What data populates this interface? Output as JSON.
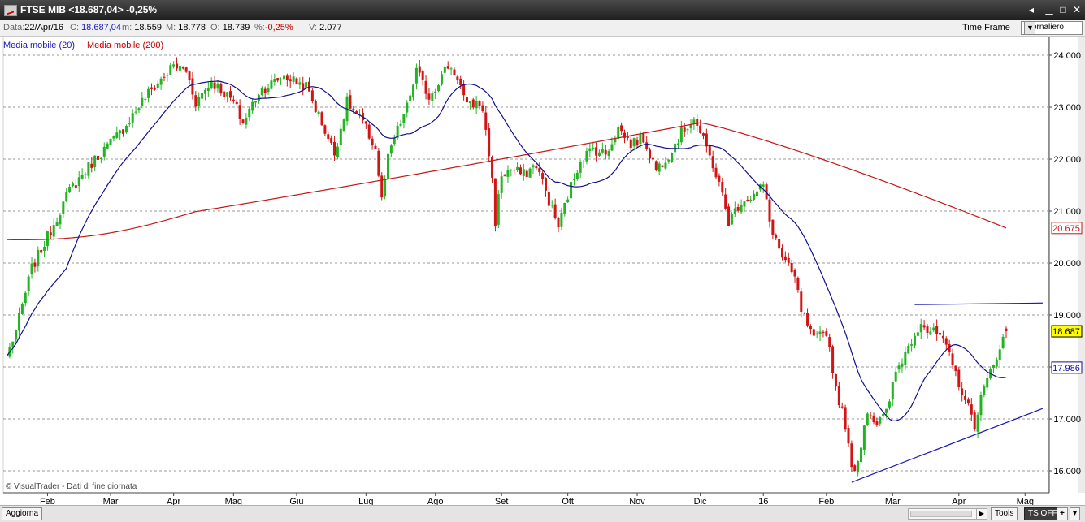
{
  "window": {
    "title": "FTSE MIB <18.687,04> -0,25%",
    "buttons": [
      "◂",
      "▁",
      "□",
      "✕"
    ],
    "app_icon": "chart-app-icon"
  },
  "infobar": {
    "data_label": "Data:",
    "data_value": "22/Apr/16",
    "c_label": "C:",
    "c_value": "18.687,04",
    "m_label": "m:",
    "m_value": "18.559",
    "M_label": "M:",
    "M_value": "18.778",
    "o_label": "O:",
    "o_value": "18.739",
    "pct_label": "%:",
    "pct_value": "-0,25%",
    "v_label": "V:",
    "v_value": "2.077",
    "timeframe_label": "Time Frame",
    "timeframe_value": "Giornaliero"
  },
  "legend": {
    "ma20": "Media mobile (20)",
    "ma200": "Media mobile (200)"
  },
  "credit": "© VisualTrader - Dati di fine giornata",
  "bottombar": {
    "refresh": "Aggiorna",
    "tools": "Tools",
    "tsoff": "TS OFF",
    "plus": "+",
    "menu": "▾"
  },
  "colors": {
    "up": "#22b422",
    "down": "#d21414",
    "ma20": "#101090",
    "ma200": "#c41818",
    "trendline": "#1a1ab4",
    "grid": "#9a9a9a",
    "price_badge": "#ffff00"
  },
  "chart_data": {
    "type": "candlestick",
    "title": "FTSE MIB <18.687,04> -0,25%",
    "ylim": [
      15600,
      24300
    ],
    "y_ticks": [
      16000,
      17000,
      18000,
      19000,
      20000,
      21000,
      22000,
      23000,
      24000
    ],
    "y_tick_labels": [
      "16.000",
      "17.000",
      "18.000",
      "19.000",
      "20.000",
      "21.000",
      "22.000",
      "23.000",
      "24.000"
    ],
    "x_ticks": [
      {
        "label": "Feb",
        "i": 13
      },
      {
        "label": "Mar",
        "i": 33
      },
      {
        "label": "Apr",
        "i": 53
      },
      {
        "label": "Mag",
        "i": 72
      },
      {
        "label": "Giu",
        "i": 92
      },
      {
        "label": "Lug",
        "i": 114
      },
      {
        "label": "Ago",
        "i": 136
      },
      {
        "label": "Set",
        "i": 157
      },
      {
        "label": "Ott",
        "i": 178
      },
      {
        "label": "Nov",
        "i": 200
      },
      {
        "label": "Dic",
        "i": 220
      },
      {
        "label": "16",
        "i": 240
      },
      {
        "label": "Feb",
        "i": 260
      },
      {
        "label": "Mar",
        "i": 281
      },
      {
        "label": "Apr",
        "i": 302
      },
      {
        "label": "Mag",
        "i": 323
      }
    ],
    "close_anchors": [
      [
        0,
        18200
      ],
      [
        3,
        18700
      ],
      [
        8,
        19900
      ],
      [
        13,
        20500
      ],
      [
        20,
        21400
      ],
      [
        28,
        22000
      ],
      [
        36,
        22500
      ],
      [
        44,
        23200
      ],
      [
        53,
        23800
      ],
      [
        57,
        23700
      ],
      [
        60,
        23100
      ],
      [
        65,
        23500
      ],
      [
        72,
        23100
      ],
      [
        75,
        22700
      ],
      [
        80,
        23300
      ],
      [
        88,
        23600
      ],
      [
        95,
        23400
      ],
      [
        100,
        22700
      ],
      [
        104,
        22100
      ],
      [
        108,
        23100
      ],
      [
        113,
        22700
      ],
      [
        117,
        22200
      ],
      [
        119,
        21200
      ],
      [
        121,
        22000
      ],
      [
        123,
        22400
      ],
      [
        127,
        23000
      ],
      [
        130,
        23700
      ],
      [
        134,
        23200
      ],
      [
        137,
        23500
      ],
      [
        140,
        23800
      ],
      [
        143,
        23600
      ],
      [
        146,
        23000
      ],
      [
        150,
        23100
      ],
      [
        152,
        22600
      ],
      [
        154,
        21600
      ],
      [
        155,
        20800
      ],
      [
        157,
        21700
      ],
      [
        160,
        21800
      ],
      [
        164,
        21700
      ],
      [
        168,
        21900
      ],
      [
        172,
        21200
      ],
      [
        175,
        20700
      ],
      [
        178,
        21300
      ],
      [
        182,
        22000
      ],
      [
        186,
        22200
      ],
      [
        190,
        22100
      ],
      [
        194,
        22600
      ],
      [
        198,
        22300
      ],
      [
        202,
        22400
      ],
      [
        206,
        21800
      ],
      [
        210,
        22100
      ],
      [
        214,
        22500
      ],
      [
        218,
        22800
      ],
      [
        220,
        22500
      ],
      [
        224,
        21900
      ],
      [
        227,
        21300
      ],
      [
        229,
        20800
      ],
      [
        233,
        21200
      ],
      [
        237,
        21300
      ],
      [
        240,
        21500
      ],
      [
        242,
        20800
      ],
      [
        246,
        20100
      ],
      [
        250,
        19700
      ],
      [
        252,
        19100
      ],
      [
        256,
        18500
      ],
      [
        260,
        18700
      ],
      [
        263,
        17600
      ],
      [
        266,
        16900
      ],
      [
        268,
        16000
      ],
      [
        270,
        16200
      ],
      [
        273,
        17200
      ],
      [
        276,
        16900
      ],
      [
        279,
        17100
      ],
      [
        282,
        17900
      ],
      [
        286,
        18400
      ],
      [
        290,
        18900
      ],
      [
        292,
        18700
      ],
      [
        296,
        18600
      ],
      [
        299,
        18200
      ],
      [
        302,
        17700
      ],
      [
        305,
        17200
      ],
      [
        307,
        16900
      ],
      [
        309,
        17400
      ],
      [
        312,
        17900
      ],
      [
        315,
        18400
      ],
      [
        317,
        18687
      ]
    ],
    "last": {
      "close": 18687.04,
      "low": 18559,
      "high": 18778,
      "open": 18739,
      "change_pct": -0.25,
      "volume": 2077
    },
    "series": [
      {
        "name": "Media mobile (20)",
        "period": 20,
        "last_value": 17986,
        "last_label": "17.986"
      },
      {
        "name": "Media mobile (200)",
        "period": 200,
        "last_value": 20675,
        "last_label": "20.675"
      }
    ],
    "price_label": "18.687",
    "trendlines": [
      {
        "from": {
          "i": 268,
          "y": 15780
        },
        "to": {
          "i": 326,
          "y": 17200
        }
      },
      {
        "from": {
          "i": 288,
          "y": 19200
        },
        "to": {
          "i": 326,
          "y": 19230
        }
      }
    ],
    "grid": "horizontal-dashed",
    "legend_position": "top-left"
  }
}
